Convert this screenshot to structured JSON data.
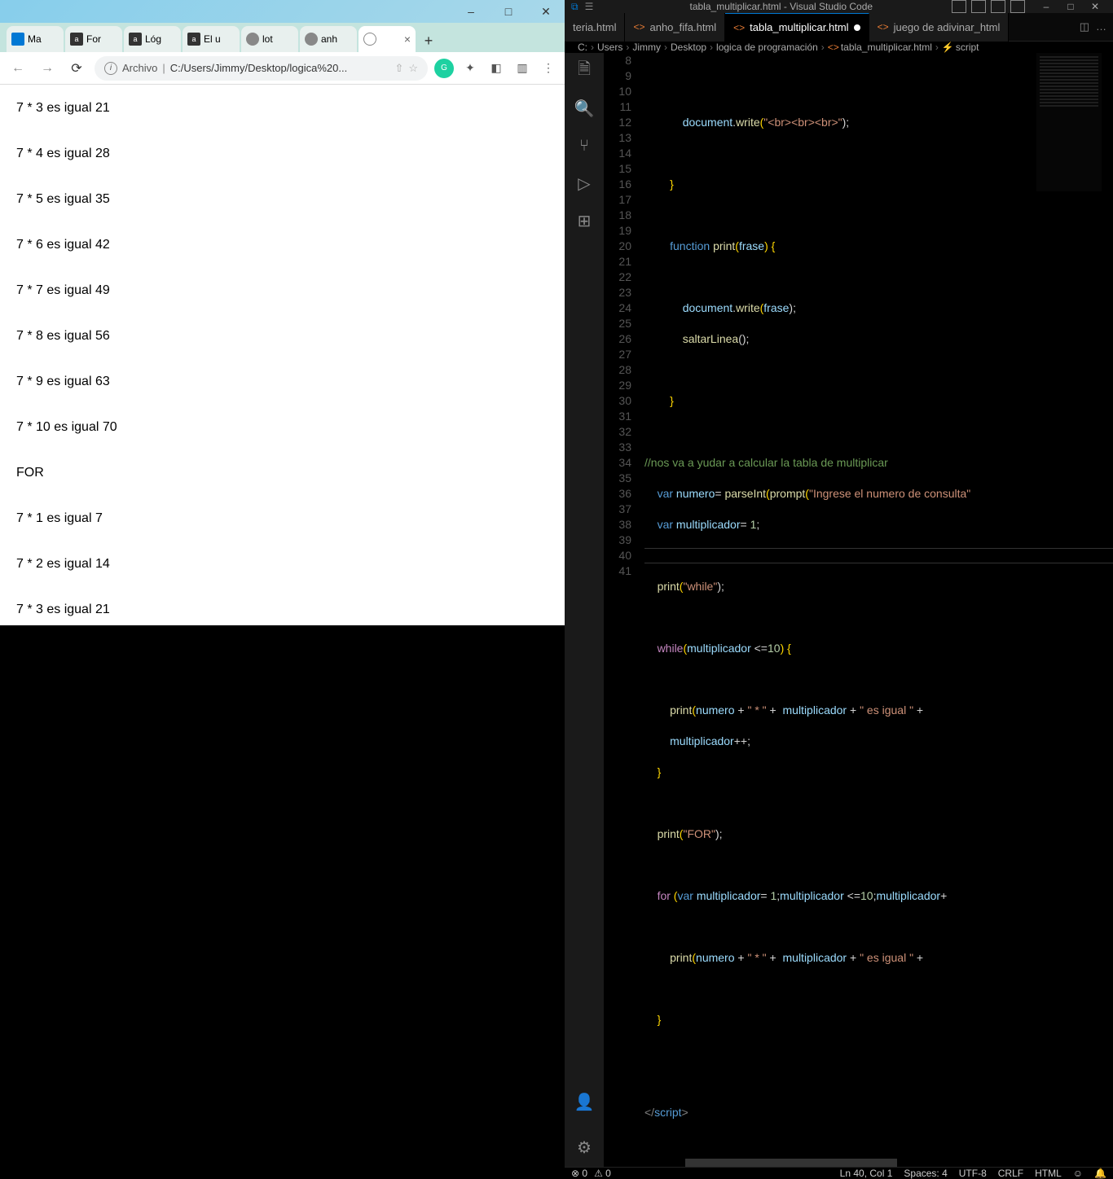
{
  "browser": {
    "win_controls": [
      "–",
      "□",
      "✕"
    ],
    "tabs": [
      {
        "label": "Ma",
        "icon": "outlook"
      },
      {
        "label": "For",
        "icon": "a"
      },
      {
        "label": "Lóg",
        "icon": "a"
      },
      {
        "label": "El u",
        "icon": "a"
      },
      {
        "label": "lot",
        "icon": "globe"
      },
      {
        "label": "anh",
        "icon": "globe"
      },
      {
        "label": "",
        "icon": "doc",
        "active": true
      }
    ],
    "address": {
      "archivo": "Archivo",
      "url": "C:/Users/Jimmy/Desktop/logica%20..."
    },
    "content_lines": [
      "7 * 3 es igual 21",
      "7 * 4 es igual 28",
      "7 * 5 es igual 35",
      "7 * 6 es igual 42",
      "7 * 7 es igual 49",
      "7 * 8 es igual 56",
      "7 * 9 es igual 63",
      "7 * 10 es igual 70",
      "FOR",
      "7 * 1 es igual 7",
      "7 * 2 es igual 14",
      "7 * 3 es igual 21"
    ]
  },
  "vscode": {
    "title": "tabla_multiplicar.html - Visual Studio Code",
    "tabs": [
      {
        "label": "teria.html"
      },
      {
        "label": "anho_fifa.html"
      },
      {
        "label": "tabla_multiplicar.html",
        "active": true,
        "modified": true
      },
      {
        "label": "juego de adivinar_html"
      }
    ],
    "breadcrumb": [
      "C:",
      "Users",
      "Jimmy",
      "Desktop",
      "logica de programación",
      "tabla_multiplicar.html",
      "script"
    ],
    "line_numbers": [
      8,
      9,
      10,
      11,
      12,
      13,
      14,
      15,
      16,
      17,
      18,
      19,
      20,
      21,
      22,
      23,
      24,
      25,
      26,
      27,
      28,
      29,
      30,
      31,
      32,
      33,
      34,
      35,
      36,
      37,
      38,
      39,
      40,
      41
    ],
    "code": {
      "l9": {
        "obj": "document",
        "dot": ".",
        "fn": "write",
        "p1": "(",
        "str": "\"<br><br><br>\"",
        "p2": ");"
      },
      "l11": "}",
      "l13": {
        "kw": "function",
        "sp": " ",
        "fn": "print",
        "p1": "(",
        "arg": "frase",
        "p2": ") ",
        "br": "{"
      },
      "l15": {
        "obj": "document",
        "dot": ".",
        "fn": "write",
        "p1": "(",
        "arg": "frase",
        "p2": ");"
      },
      "l16": {
        "fn": "saltarLinea",
        "p": "();"
      },
      "l18": "}",
      "l20": "//nos va a yudar a calcular la tabla de multiplicar",
      "l21": {
        "kw": "var",
        "sp": " ",
        "v": "numero",
        "eq": "= ",
        "fn": "parseInt",
        "p1": "(",
        "fn2": "prompt",
        "p2": "(",
        "str": "\"Ingrese el numero de consulta\"",
        "end": ""
      },
      "l22": {
        "kw": "var",
        "sp": " ",
        "v": "multiplicador",
        "eq": "= ",
        "n": "1",
        "end": ";"
      },
      "l24": {
        "fn": "print",
        "p1": "(",
        "str": "\"while\"",
        "p2": ");"
      },
      "l26": {
        "kw": "while",
        "p1": "(",
        "v": "multiplicador",
        "op": " <=",
        "n": "10",
        "p2": ") ",
        "br": "{"
      },
      "l28": {
        "fn": "print",
        "p1": "(",
        "v1": "numero",
        "op1": " + ",
        "s1": "\" * \"",
        "op2": " +  ",
        "v2": "multiplicador",
        "op3": " + ",
        "s2": "\" es igual \"",
        "op4": " + "
      },
      "l29": {
        "v": "multiplicador",
        "op": "++;"
      },
      "l30": "}",
      "l32": {
        "fn": "print",
        "p1": "(",
        "str": "\"FOR\"",
        "p2": ");"
      },
      "l34": {
        "kw": "for",
        "sp": " ",
        "p1": "(",
        "kw2": "var",
        "sp2": " ",
        "v": "multiplicador",
        "eq": "= ",
        "n": "1",
        "sc": ";",
        "v2": "multiplicador",
        "op": " <=",
        "n2": "10",
        "sc2": ";",
        "v3": "multiplicador",
        "inc": "+"
      },
      "l36": {
        "fn": "print",
        "p1": "(",
        "v1": "numero",
        "op1": " + ",
        "s1": "\" * \"",
        "op2": " +  ",
        "v2": "multiplicador",
        "op3": " + ",
        "s2": "\" es igual \"",
        "op4": " + "
      },
      "l38": "}",
      "l41": {
        "open": "</",
        "tag": "script",
        "close": ">"
      }
    },
    "status": {
      "errors": "⊗ 0",
      "warnings": "⚠ 0",
      "ln": "Ln 40, Col 1",
      "spaces": "Spaces: 4",
      "encoding": "UTF-8",
      "eol": "CRLF",
      "lang": "HTML",
      "feedback": "☺",
      "bell": "🔔"
    }
  }
}
